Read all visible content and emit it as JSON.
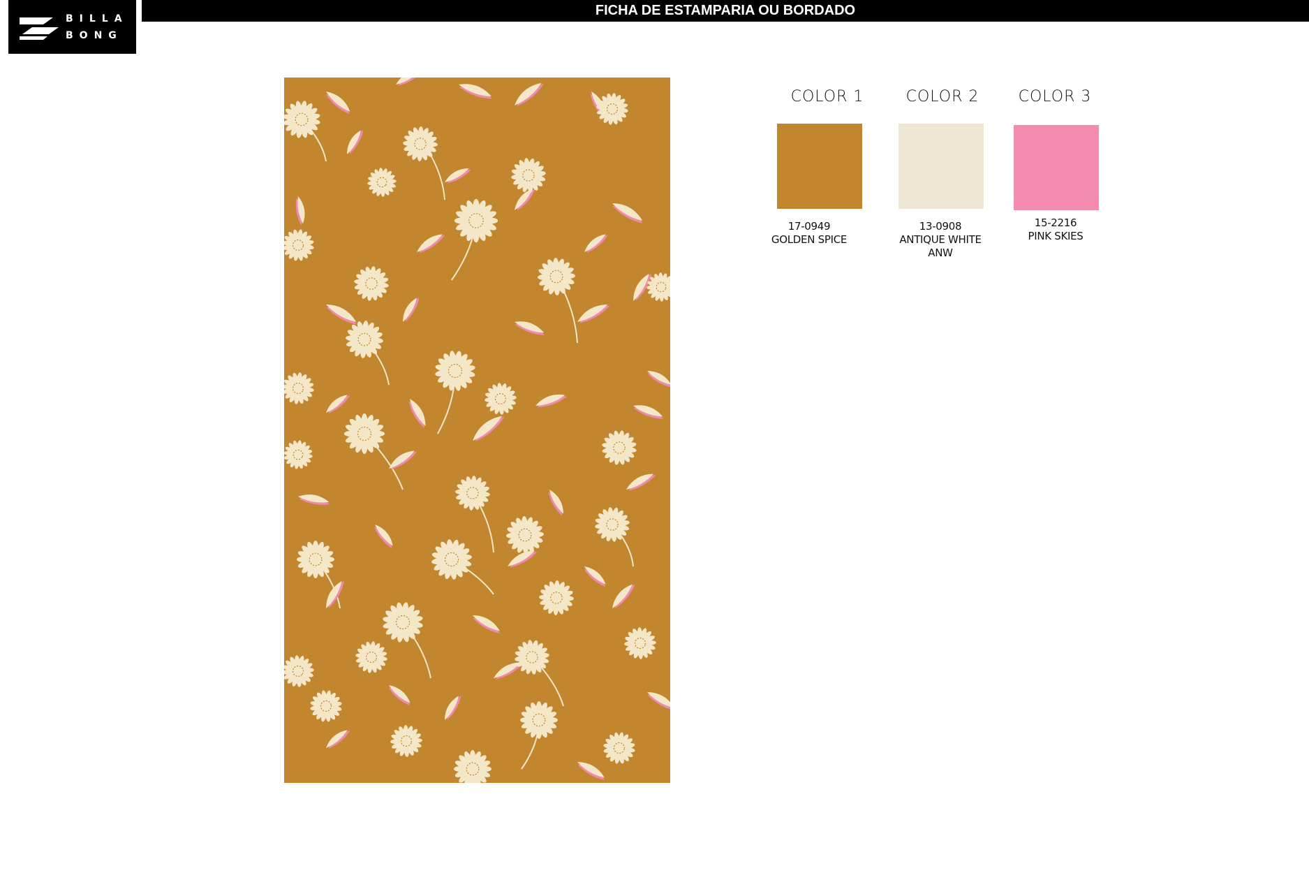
{
  "header": {
    "logo": {
      "line1": "BILLA",
      "line2": "BONG"
    },
    "title": "FICHA DE ESTAMPARIA OU BORDADO"
  },
  "print": {
    "background_color": "#c1862e",
    "motif_color": "#f3e7c7",
    "accent_color": "#f08ab0",
    "motif_icon": "daisy-flower-icon"
  },
  "colors": [
    {
      "heading": "COLOR 1",
      "hex": "#c1862e",
      "code": "17-0949",
      "name": "GOLDEN SPICE",
      "extra": ""
    },
    {
      "heading": "COLOR 2",
      "hex": "#f0e6d4",
      "code": "13-0908",
      "name": "ANTIQUE WHITE",
      "extra": "ANW"
    },
    {
      "heading": "COLOR 3",
      "hex": "#f48bb0",
      "code": "15-2216",
      "name": "PINK SKIES",
      "extra": ""
    }
  ]
}
